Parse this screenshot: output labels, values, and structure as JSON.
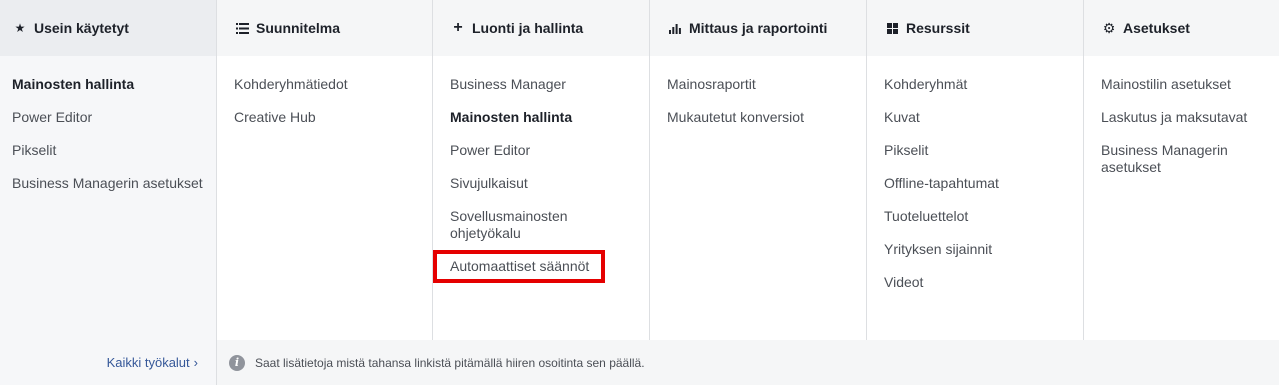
{
  "columns": [
    {
      "title": "Usein käytetyt",
      "icon": "★",
      "items": [
        "Mainosten hallinta",
        "Power Editor",
        "Pikselit",
        "Business Managerin asetukset"
      ],
      "active_index": 0
    },
    {
      "title": "Suunnitelma",
      "icon": "☰",
      "items": [
        "Kohderyhmätiedot",
        "Creative Hub"
      ],
      "active_index": -1
    },
    {
      "title": "Luonti ja hallinta",
      "icon": "+",
      "items": [
        "Business Manager",
        "Mainosten hallinta",
        "Power Editor",
        "Sivujulkaisut",
        "Sovellusmainosten ohjetyökalu",
        "Automaattiset säännöt"
      ],
      "active_index": 1,
      "highlighted_index": 5
    },
    {
      "title": "Mittaus ja raportointi",
      "icon": "bar-chart",
      "items": [
        "Mainosraportit",
        "Mukautetut konversiot"
      ],
      "active_index": -1
    },
    {
      "title": "Resurssit",
      "icon": "grid",
      "items": [
        "Kohderyhmät",
        "Kuvat",
        "Pikselit",
        "Offline-tapahtumat",
        "Tuoteluettelot",
        "Yrityksen sijainnit",
        "Videot"
      ],
      "active_index": -1
    },
    {
      "title": "Asetukset",
      "icon": "⚙",
      "items": [
        "Mainostilin asetukset",
        "Laskutus ja maksutavat",
        "Business Managerin asetukset"
      ],
      "active_index": -1
    }
  ],
  "footer": {
    "all_tools_label": "Kaikki työkalut",
    "info_text": "Saat lisätietoja mistä tahansa linkistä pitämällä hiiren osoitinta sen päällä."
  },
  "colors": {
    "highlight": "#e50000",
    "link": "#365899"
  }
}
